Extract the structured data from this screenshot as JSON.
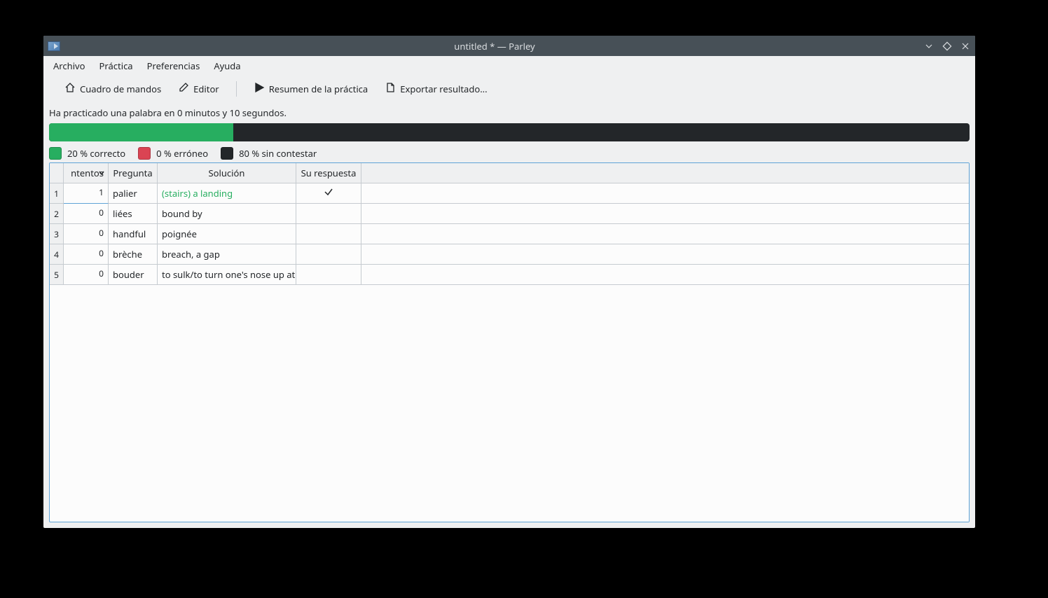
{
  "window": {
    "title": "untitled * — Parley"
  },
  "menubar": {
    "items": [
      "Archivo",
      "Práctica",
      "Preferencias",
      "Ayuda"
    ]
  },
  "toolbar": {
    "dashboard": "Cuadro de mandos",
    "editor": "Editor",
    "summary": "Resumen de la práctica",
    "export": "Exportar resultado..."
  },
  "status": "Ha practicado una palabra en 0 minutos y 10 segundos.",
  "progress": {
    "correct_pct": 20,
    "wrong_pct": 0,
    "unanswered_pct": 80
  },
  "legend": {
    "correct": "20 % correcto",
    "wrong": "0 % erróneo",
    "unanswered": "80 % sin contestar"
  },
  "table": {
    "headers": {
      "attempts": "ntentos",
      "question": "Pregunta",
      "solution": "Solución",
      "response": "Su respuesta"
    },
    "rows": [
      {
        "n": "1",
        "attempts": "1",
        "question": "palier",
        "solution": "(stairs) a landing",
        "response": "check",
        "correct": true
      },
      {
        "n": "2",
        "attempts": "0",
        "question": "liées",
        "solution": "bound by",
        "response": "",
        "correct": false
      },
      {
        "n": "3",
        "attempts": "0",
        "question": "handful",
        "solution": "poignée",
        "response": "",
        "correct": false
      },
      {
        "n": "4",
        "attempts": "0",
        "question": "brèche",
        "solution": "breach, a gap",
        "response": "",
        "correct": false
      },
      {
        "n": "5",
        "attempts": "0",
        "question": "bouder",
        "solution": "to sulk/to turn one's nose up at",
        "response": "",
        "correct": false
      }
    ]
  }
}
